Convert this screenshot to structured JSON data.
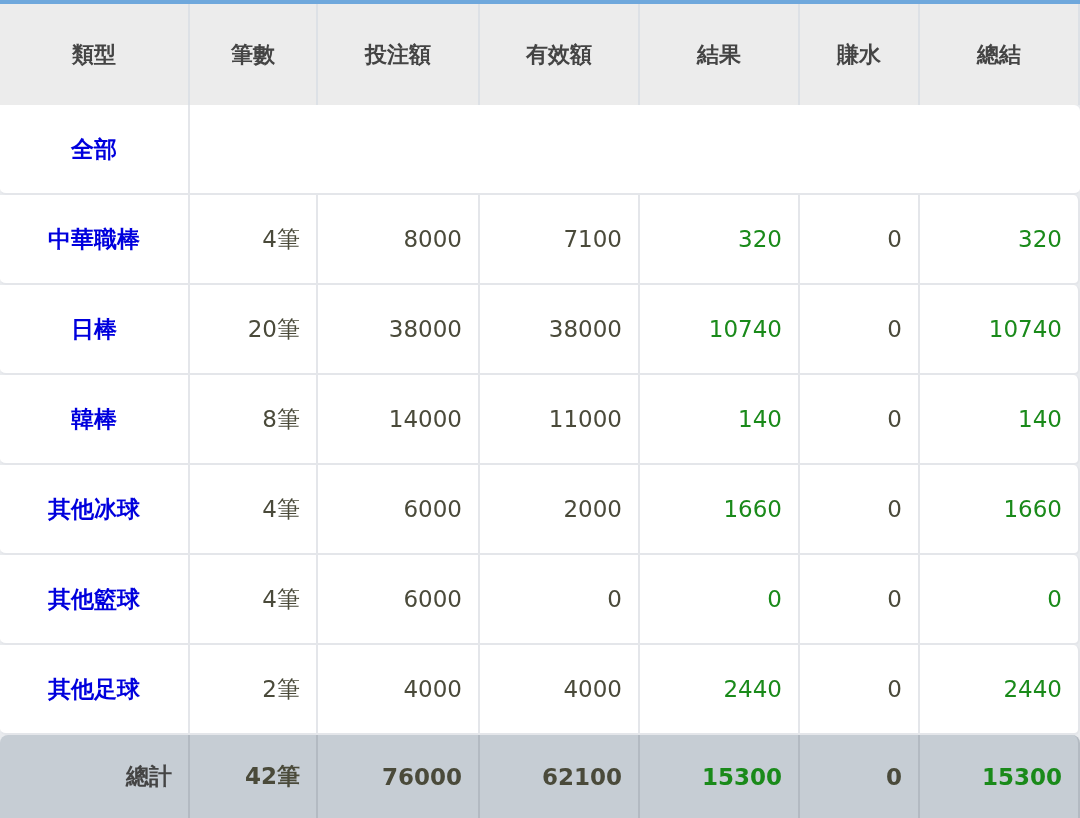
{
  "table": {
    "columns": [
      {
        "label": "類型",
        "color": "#0000dd"
      },
      {
        "label": "筆數",
        "color": "#4a4a3a"
      },
      {
        "label": "投注額",
        "color": "#4a4a3a"
      },
      {
        "label": "有效額",
        "color": "#4a4a3a"
      },
      {
        "label": "結果",
        "color": "#1a8a1a"
      },
      {
        "label": "賺水",
        "color": "#4a4a3a"
      },
      {
        "label": "總結",
        "color": "#1a8a1a"
      }
    ],
    "rows": [
      {
        "type": "全部",
        "cells": []
      },
      {
        "type": "中華職棒",
        "cells": [
          "4筆",
          "8000",
          "7100",
          "320",
          "0",
          "320"
        ]
      },
      {
        "type": "日棒",
        "cells": [
          "20筆",
          "38000",
          "38000",
          "10740",
          "0",
          "10740"
        ]
      },
      {
        "type": "韓棒",
        "cells": [
          "8筆",
          "14000",
          "11000",
          "140",
          "0",
          "140"
        ]
      },
      {
        "type": "其他冰球",
        "cells": [
          "4筆",
          "6000",
          "2000",
          "1660",
          "0",
          "1660"
        ]
      },
      {
        "type": "其他籃球",
        "cells": [
          "4筆",
          "6000",
          "0",
          "0",
          "0",
          "0"
        ]
      },
      {
        "type": "其他足球",
        "cells": [
          "2筆",
          "4000",
          "4000",
          "2440",
          "0",
          "2440"
        ]
      }
    ],
    "total": {
      "label": "總計",
      "cells": [
        "42筆",
        "76000",
        "62100",
        "15300",
        "0",
        "15300"
      ]
    }
  }
}
